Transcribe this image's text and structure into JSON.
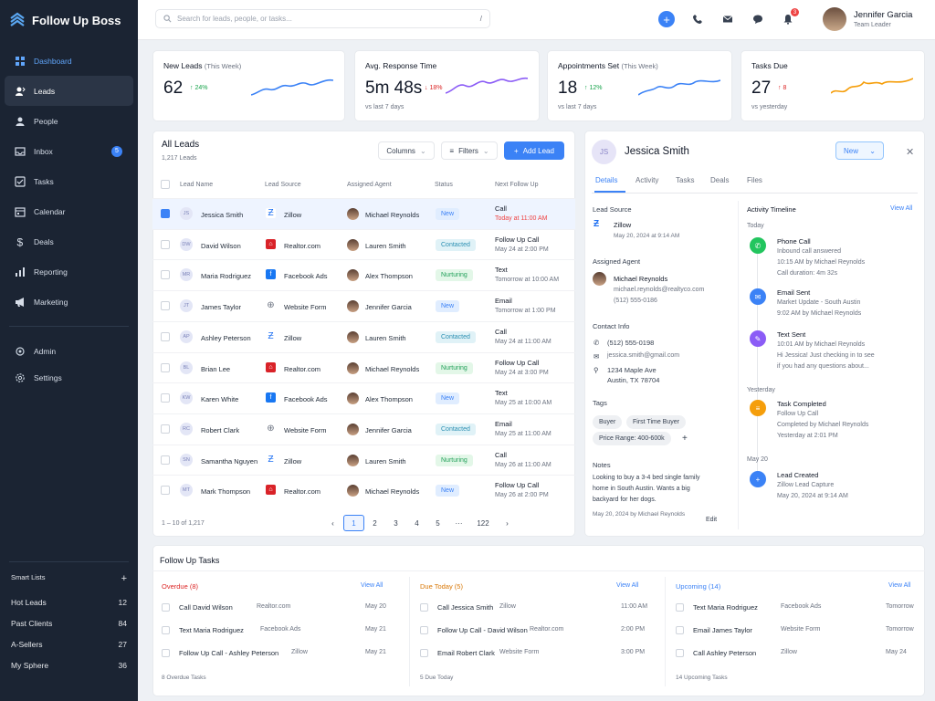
{
  "app": {
    "name": "Follow Up Boss"
  },
  "colors": {
    "sidebar": "#1b2433",
    "accent": "#3b82f6",
    "positive": "#16a34a",
    "negative": "#dc2626"
  },
  "nav": {
    "items": [
      {
        "label": "Dashboard",
        "icon": "grid-icon"
      },
      {
        "label": "Leads",
        "icon": "leads-icon"
      },
      {
        "label": "People",
        "icon": "person-icon"
      },
      {
        "label": "Inbox",
        "icon": "inbox-icon",
        "badge": "5"
      },
      {
        "label": "Tasks",
        "icon": "task-icon"
      },
      {
        "label": "Calendar",
        "icon": "calendar-icon"
      },
      {
        "label": "Deals",
        "icon": "dollar-icon"
      },
      {
        "label": "Reporting",
        "icon": "bar-chart-icon"
      },
      {
        "label": "Marketing",
        "icon": "megaphone-icon"
      }
    ],
    "admin": "Admin",
    "settings": "Settings"
  },
  "smart_lists": {
    "title": "Smart Lists",
    "add": "+",
    "items": [
      {
        "label": "Hot Leads",
        "count": "12"
      },
      {
        "label": "Past Clients",
        "count": "84"
      },
      {
        "label": "A-Sellers",
        "count": "27"
      },
      {
        "label": "My Sphere",
        "count": "36"
      }
    ]
  },
  "topbar": {
    "search_placeholder": "Search for leads, people, or tasks...",
    "shortcut": "/",
    "notif_count": "3",
    "user_name": "Jennifer Garcia",
    "user_role": "Team Leader"
  },
  "stats": [
    {
      "title": "New Leads",
      "qual": "(This Week)",
      "value": "62",
      "change": "24%",
      "dir": "up",
      "sub": ""
    },
    {
      "title": "Avg. Response Time",
      "qual": "",
      "value": "5m 48s",
      "change": "18%",
      "dir": "down",
      "sub": "vs last 7 days"
    },
    {
      "title": "Appointments Set",
      "qual": "(This Week)",
      "value": "18",
      "change": "12%",
      "dir": "up",
      "sub": "vs last 7 days"
    },
    {
      "title": "Tasks Due",
      "qual": "",
      "value": "27",
      "change": "8",
      "dir": "up",
      "sub": "vs yesterday"
    }
  ],
  "leads": {
    "title": "All Leads",
    "count": "1,217 Leads",
    "columns_btn": "Columns",
    "filters_btn": "Filters",
    "add_btn": "Add Lead",
    "headers": [
      "Lead Name",
      "Lead Source",
      "Assigned Agent",
      "Status",
      "Next Follow Up"
    ],
    "rows": [
      {
        "initials": "JS",
        "name": "Jessica Smith",
        "source": "Zillow",
        "agent": "Michael Reynolds",
        "status": "New",
        "fu_type": "Call",
        "fu_time": "Today at 11:00 AM"
      },
      {
        "initials": "DW",
        "name": "David Wilson",
        "source": "Realtor.com",
        "agent": "Lauren Smith",
        "status": "Contacted",
        "fu_type": "Follow Up Call",
        "fu_time": "May 24 at 2:00 PM"
      },
      {
        "initials": "MR",
        "name": "Maria Rodriguez",
        "source": "Facebook Ads",
        "agent": "Alex Thompson",
        "status": "Nurturing",
        "fu_type": "Text",
        "fu_time": "Tomorrow at 10:00 AM"
      },
      {
        "initials": "JT",
        "name": "James Taylor",
        "source": "Website Form",
        "agent": "Jennifer Garcia",
        "status": "New",
        "fu_type": "Email",
        "fu_time": "Tomorrow at 1:00 PM"
      },
      {
        "initials": "AP",
        "name": "Ashley Peterson",
        "source": "Zillow",
        "agent": "Lauren Smith",
        "status": "Contacted",
        "fu_type": "Call",
        "fu_time": "May 24 at 11:00 AM"
      },
      {
        "initials": "BL",
        "name": "Brian Lee",
        "source": "Realtor.com",
        "agent": "Michael Reynolds",
        "status": "Nurturing",
        "fu_type": "Follow Up Call",
        "fu_time": "May 24 at 3:00 PM"
      },
      {
        "initials": "KW",
        "name": "Karen White",
        "source": "Facebook Ads",
        "agent": "Alex Thompson",
        "status": "New",
        "fu_type": "Text",
        "fu_time": "May 25 at 10:00 AM"
      },
      {
        "initials": "RC",
        "name": "Robert Clark",
        "source": "Website Form",
        "agent": "Jennifer Garcia",
        "status": "Contacted",
        "fu_type": "Email",
        "fu_time": "May 25 at 11:00 AM"
      },
      {
        "initials": "SN",
        "name": "Samantha Nguyen",
        "source": "Zillow",
        "agent": "Lauren Smith",
        "status": "Nurturing",
        "fu_type": "Call",
        "fu_time": "May 26 at 11:00 AM"
      },
      {
        "initials": "MT",
        "name": "Mark Thompson",
        "source": "Realtor.com",
        "agent": "Michael Reynolds",
        "status": "New",
        "fu_type": "Follow Up Call",
        "fu_time": "May 26 at 2:00 PM"
      }
    ],
    "range": "1 – 10 of 1,217",
    "pages": [
      "‹",
      "1",
      "2",
      "3",
      "4",
      "5",
      "···",
      "122",
      "›"
    ]
  },
  "detail": {
    "initials": "JS",
    "name": "Jessica Smith",
    "status": "New",
    "tabs": [
      "Details",
      "Activity",
      "Tasks",
      "Deals",
      "Files"
    ],
    "lead_source_label": "Lead Source",
    "source": "Zillow",
    "source_date": "May 20, 2024 at 9:14 AM",
    "agent_label": "Assigned Agent",
    "agent_name": "Michael Reynolds",
    "agent_email": "michael.reynolds@realtyco.com",
    "agent_phone": "(512) 555-0186",
    "contact_label": "Contact Info",
    "phone": "(512) 555-0198",
    "email": "jessica.smith@gmail.com",
    "addr1": "1234 Maple Ave",
    "addr2": "Austin, TX 78704",
    "tags_label": "Tags",
    "tags": [
      "Buyer",
      "First Time Buyer",
      "Price Range: 400-600k"
    ],
    "tag_add": "+",
    "notes_label": "Notes",
    "note_l1": "Looking to buy a 3-4 bed single family",
    "note_l2": "home in South Austin. Wants a big",
    "note_l3": "backyard for her dogs.",
    "note_meta": "May 20, 2024 by Michael Reynolds",
    "edit": "Edit",
    "timeline_title": "Activity Timeline",
    "view_all": "View All",
    "timeline": [
      {
        "group": "Today",
        "title": "Phone Call",
        "l1": "Inbound call answered",
        "l2": "10:15 AM by Michael Reynolds",
        "l3": "Call duration: 4m 32s",
        "color": "#22c55e"
      },
      {
        "group": "",
        "title": "Email Sent",
        "l1": "Market Update - South Austin",
        "l2": "9:02 AM by Michael Reynolds",
        "l3": "",
        "color": "#3b82f6"
      },
      {
        "group": "",
        "title": "Text Sent",
        "l1": "10:01 AM by Michael Reynolds",
        "l2": "Hi Jessica! Just checking in to see",
        "l3": "if you had any questions about...",
        "color": "#8b5cf6"
      },
      {
        "group": "Yesterday",
        "title": "Task Completed",
        "l1": "Follow Up Call",
        "l2": "Completed by Michael Reynolds",
        "l3": "Yesterday at 2:01 PM",
        "color": "#f59e0b"
      },
      {
        "group": "May 20",
        "title": "Lead Created",
        "l1": "Zillow Lead Capture",
        "l2": "May 20, 2024 at 9:14 AM",
        "l3": "",
        "color": "#3b82f6"
      }
    ]
  },
  "tasks": {
    "title": "Follow Up Tasks",
    "view_all": "View All",
    "overdue": {
      "label": "Overdue (8)",
      "footer": "8 Overdue Tasks",
      "items": [
        {
          "t": "Call David Wilson",
          "s": "Realtor.com",
          "d": "May 20"
        },
        {
          "t": "Text Maria Rodriguez",
          "s": "Facebook Ads",
          "d": "May 21"
        },
        {
          "t": "Follow Up Call - Ashley Peterson",
          "s": "Zillow",
          "d": "May 21"
        }
      ]
    },
    "due": {
      "label": "Due Today (5)",
      "footer": "5 Due Today",
      "items": [
        {
          "t": "Call Jessica Smith",
          "s": "Zillow",
          "d": "11:00 AM"
        },
        {
          "t": "Follow Up Call - David Wilson",
          "s": "Realtor.com",
          "d": "2:00 PM"
        },
        {
          "t": "Email Robert Clark",
          "s": "Website Form",
          "d": "3:00 PM"
        }
      ]
    },
    "upcoming": {
      "label": "Upcoming (14)",
      "footer": "14 Upcoming Tasks",
      "items": [
        {
          "t": "Text Maria Rodriguez",
          "s": "Facebook Ads",
          "d": "Tomorrow"
        },
        {
          "t": "Email James Taylor",
          "s": "Website Form",
          "d": "Tomorrow"
        },
        {
          "t": "Call Ashley Peterson",
          "s": "Zillow",
          "d": "May 24"
        }
      ]
    }
  }
}
